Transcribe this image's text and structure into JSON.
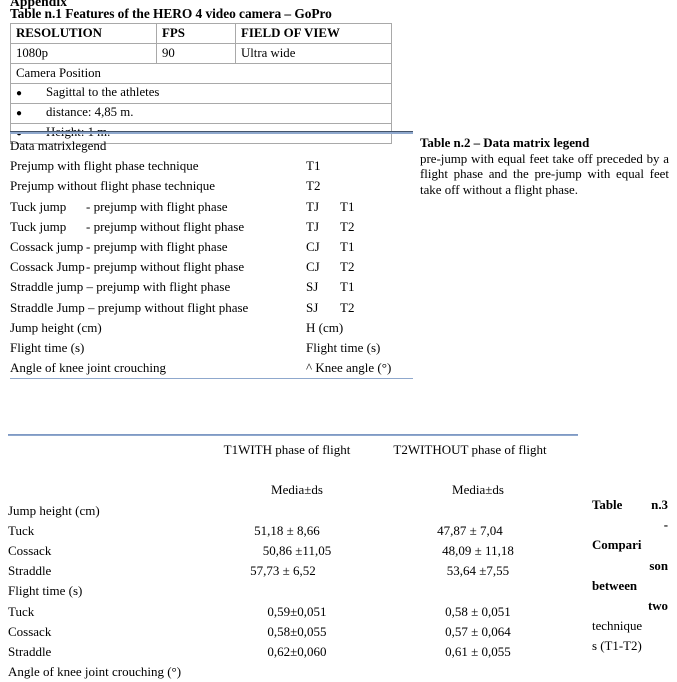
{
  "document": {
    "appendix_heading": "Appendix",
    "table1": {
      "caption": "Table n.1 Features of the HERO 4 video camera – GoPro",
      "headers": [
        "RESOLUTION",
        "FPS",
        "FIELD OF VIEW"
      ],
      "values": [
        "1080p",
        "90",
        "Ultra wide"
      ],
      "section_label": "Camera Position",
      "bullet_marker": "●",
      "bullets": [
        "Sagittal to the athletes",
        "distance: 4,85 m.",
        "Height: 1 m."
      ]
    },
    "legend": {
      "title": "Data matrixlegend",
      "rows": [
        {
          "label": "Prejump with flight phase technique",
          "label2": "",
          "code1": "T1",
          "code2": ""
        },
        {
          "label": "Prejump without flight phase technique",
          "label2": "",
          "code1": "T2",
          "code2": ""
        },
        {
          "label": "Tuck jump",
          "label2": "- prejump with flight phase",
          "code1": "TJ",
          "code2": "T1"
        },
        {
          "label": "Tuck jump",
          "label2": "- prejump without flight phase",
          "code1": "TJ",
          "code2": "T2"
        },
        {
          "label": "Cossack jump",
          "label2": "- prejump with flight phase",
          "code1": "CJ",
          "code2": "T1"
        },
        {
          "label": "Cossack Jump",
          "label2": "- prejump without flight phase",
          "code1": "CJ",
          "code2": "T2"
        },
        {
          "label": "Straddle jump – prejump with flight phase",
          "label2": "",
          "code1": "SJ",
          "code2": "T1"
        },
        {
          "label": "Straddle Jump – prejump without flight phase",
          "label2": "",
          "code1": "SJ",
          "code2": "T2"
        },
        {
          "label": "Jump height (cm)",
          "label2": "",
          "code1": "H (cm)",
          "code2": ""
        },
        {
          "label": "Flight time (s)",
          "label2": "",
          "code1": "Flight time (s)",
          "code2": ""
        },
        {
          "label": "Angle of knee joint crouching",
          "label2": "",
          "code1": "^ Knee angle (°)",
          "code2": ""
        }
      ]
    },
    "table2": {
      "title": "Table n.2 – Data matrix legend",
      "body": "pre-jump with equal feet take off preceded by a flight phase and the pre-jump with equal feet take off without a flight phase."
    },
    "table3": {
      "col1_header": "T1WITH phase of flight",
      "col2_header": "T2WITHOUT phase of flight",
      "col1_subheader": "Media±ds",
      "col2_subheader": "Media±ds",
      "sections": [
        {
          "title": "Jump height (cm)",
          "rows": [
            {
              "label": "Tuck",
              "v1": "51,18 ± 8,66",
              "v2": "47,87 ±  7,04"
            },
            {
              "label": "Cossack",
              "v1": "50,86 ±11,05",
              "v2": "48,09 ± 11,18"
            },
            {
              "label": "Straddle",
              "v1": "57,73 ± 6,52",
              "v2": "53,64 ±7,55"
            }
          ]
        },
        {
          "title": "Flight time (s)",
          "rows": [
            {
              "label": "Tuck",
              "v1": "0,59±0,051",
              "v2": "0,58 ± 0,051"
            },
            {
              "label": "Cossack",
              "v1": "0,58±0,055",
              "v2": "0,57 ± 0,064"
            },
            {
              "label": "Straddle",
              "v1": "0,62±0,060",
              "v2": "0,61 ± 0,055"
            }
          ]
        }
      ],
      "last_section_title": "Angle of knee joint crouching (°)",
      "caption_lines": [
        {
          "text": "Table  n.3",
          "bold": true,
          "align": "justify"
        },
        {
          "text": "-",
          "bold": true,
          "align": "right"
        },
        {
          "text": "Compari",
          "bold": true,
          "align": "left"
        },
        {
          "text": "son",
          "bold": true,
          "align": "right"
        },
        {
          "text": "between",
          "bold": true,
          "align": "left"
        },
        {
          "text": "two",
          "bold": true,
          "align": "right"
        },
        {
          "text": "technique",
          "bold": false,
          "align": "left"
        },
        {
          "text": "s (T1-T2)",
          "bold": false,
          "align": "left"
        }
      ]
    },
    "colors": {
      "rule_dark": "#44546a",
      "rule_blue": "#8fa8cd",
      "table_border": "#a9a9a9",
      "text": "#000000"
    }
  }
}
